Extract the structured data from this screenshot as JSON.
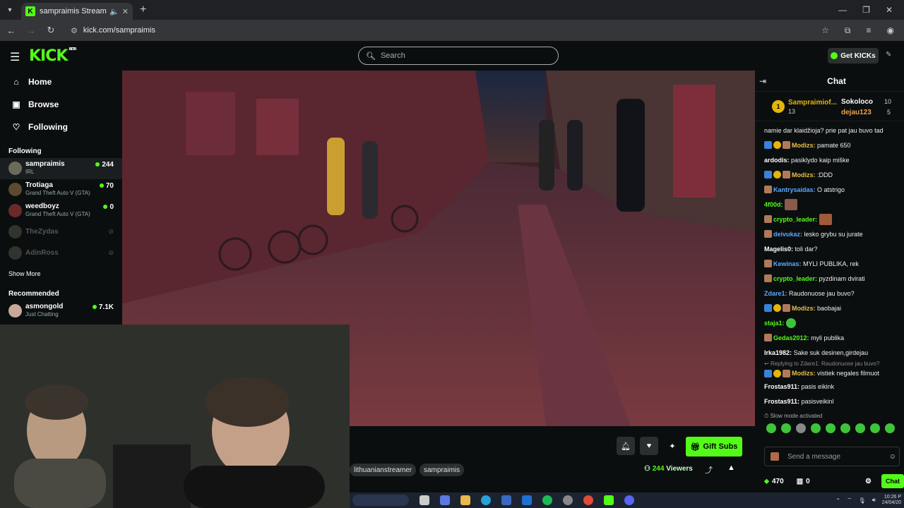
{
  "browser": {
    "tab_title": "sampraimis Stream - Watch",
    "tab_icon": "K",
    "url": "kick.com/sampraimis"
  },
  "header": {
    "logo": "KICK",
    "logo_badge": "BETA",
    "search_placeholder": "Search",
    "get_kicks_label": "Get KICKs"
  },
  "sidebar": {
    "nav": [
      {
        "label": "Home",
        "icon": "home-icon"
      },
      {
        "label": "Browse",
        "icon": "browse-icon"
      },
      {
        "label": "Following",
        "icon": "heart-icon"
      }
    ],
    "following_header": "Following",
    "following": [
      {
        "name": "sampraimis",
        "category": "IRL",
        "viewers": "244"
      },
      {
        "name": "Trotiaga",
        "category": "Grand Theft Auto V (GTA)",
        "viewers": "70"
      },
      {
        "name": "weedboyz",
        "category": "Grand Theft Auto V (GTA)",
        "viewers": "0"
      },
      {
        "name": "TheZydas",
        "category": "",
        "viewers": ""
      },
      {
        "name": "AdinRoss",
        "category": "",
        "viewers": ""
      }
    ],
    "show_more": "Show More",
    "recommended_header": "Recommended",
    "recommended": [
      {
        "name": "asmongold",
        "category": "Just Chatting",
        "viewers": "7.1K"
      }
    ]
  },
  "stream": {
    "tags": [
      "lithuanianstreamer",
      "sampraimis"
    ],
    "gift_subs_label": "Gift Subs",
    "viewers_count": "244",
    "viewers_label": "Viewers"
  },
  "chat": {
    "title": "Chat",
    "pinned": {
      "top1_rank": "1",
      "top1_name": "Sampraimiof...",
      "top1_count": "13",
      "top2_name": "Sokoloco",
      "top2_count": "10",
      "top3_name": "dejau123",
      "top3_count": "5"
    },
    "messages": [
      {
        "user": "",
        "text": "namie dar klaidžioja? prie pat jau buvo tad",
        "color": "#ffffff"
      },
      {
        "user": "Modizs:",
        "text": "pamate 650",
        "color": "#e5c14a"
      },
      {
        "user": "ardodis:",
        "text": "pasiklydo kaip miške",
        "color": "#ffffff"
      },
      {
        "user": "Modizs:",
        "text": ":DDD",
        "color": "#e5c14a"
      },
      {
        "user": "Kantrysaidas:",
        "text": "O atstrigo",
        "color": "#5aa8ff"
      },
      {
        "user": "4f00d:",
        "text": "",
        "color": "#53fc18"
      },
      {
        "user": "crypto_leader:",
        "text": "",
        "color": "#53fc18"
      },
      {
        "user": "deivukaz:",
        "text": "lesko grybu su jurate",
        "color": "#5aa8ff"
      },
      {
        "user": "Magelis0:",
        "text": "toli dar?",
        "color": "#ffffff"
      },
      {
        "user": "Kewinas:",
        "text": "MYLI PUBLIKA, rek",
        "color": "#5aa8ff"
      },
      {
        "user": "crypto_leader:",
        "text": "pyzdinam dvirati",
        "color": "#53fc18"
      },
      {
        "user": "Zdare1:",
        "text": "Raudonuose jau buvo?",
        "color": "#5aa8ff"
      },
      {
        "user": "Modizs:",
        "text": "baobajai",
        "color": "#e5c14a"
      },
      {
        "user": "staja1:",
        "text": "",
        "color": "#53fc18"
      },
      {
        "user": "Gedas2012:",
        "text": "myli publika",
        "color": "#53fc18"
      },
      {
        "user": "Irka1982:",
        "text": "Sake suk desinen,girdejau",
        "color": "#ffffff"
      },
      {
        "user": "Modizs:",
        "text": "vistiek negales filmuot",
        "color": "#e5c14a"
      },
      {
        "user": "Frostas911:",
        "text": "pasis eikink",
        "color": "#ffffff"
      },
      {
        "user": "Frostas911:",
        "text": "pasisveikinl",
        "color": "#ffffff"
      }
    ],
    "reply_note": "Replying to Zdare1: Raudonuose jau buvo?",
    "slow_mode": "Slow mode activated",
    "send_placeholder": "Send a message",
    "kicks_count": "470",
    "subs_count": "0",
    "chat_button": "Chat"
  },
  "taskbar": {
    "time": "10:26 P",
    "date": "24/04/20"
  },
  "colors": {
    "brand": "#53fc18",
    "background": "#0b0e0f"
  }
}
